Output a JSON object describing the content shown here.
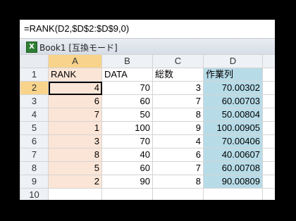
{
  "formula_bar": {
    "text": "=RANK(D2,$D$2:$D$9,0)"
  },
  "window": {
    "app_icon": "excel-icon",
    "icon_glyph": "X",
    "title": "Book1 [互換モード]"
  },
  "grid": {
    "columns": [
      "A",
      "B",
      "C",
      "D"
    ],
    "selected_column": "A",
    "selected_row": "2",
    "header_row": {
      "row": "1",
      "cells": [
        "RANK",
        "DATA",
        "総数",
        "作業列"
      ]
    },
    "rows": [
      {
        "row": "2",
        "cells": [
          "4",
          "70",
          "3",
          "70.00302"
        ]
      },
      {
        "row": "3",
        "cells": [
          "6",
          "60",
          "7",
          "60.00703"
        ]
      },
      {
        "row": "4",
        "cells": [
          "7",
          "50",
          "8",
          "50.00804"
        ]
      },
      {
        "row": "5",
        "cells": [
          "1",
          "100",
          "9",
          "100.00905"
        ]
      },
      {
        "row": "6",
        "cells": [
          "3",
          "70",
          "4",
          "70.00406"
        ]
      },
      {
        "row": "7",
        "cells": [
          "8",
          "40",
          "6",
          "40.00607"
        ]
      },
      {
        "row": "8",
        "cells": [
          "5",
          "60",
          "7",
          "60.00708"
        ]
      },
      {
        "row": "9",
        "cells": [
          "2",
          "90",
          "8",
          "90.00809"
        ]
      },
      {
        "row": "10",
        "cells": [
          "",
          "",
          "",
          ""
        ]
      }
    ]
  },
  "colors": {
    "rank_fill": "#fbe5d6",
    "work_fill": "#b7dce8",
    "selected_header": "#f8d38b"
  }
}
